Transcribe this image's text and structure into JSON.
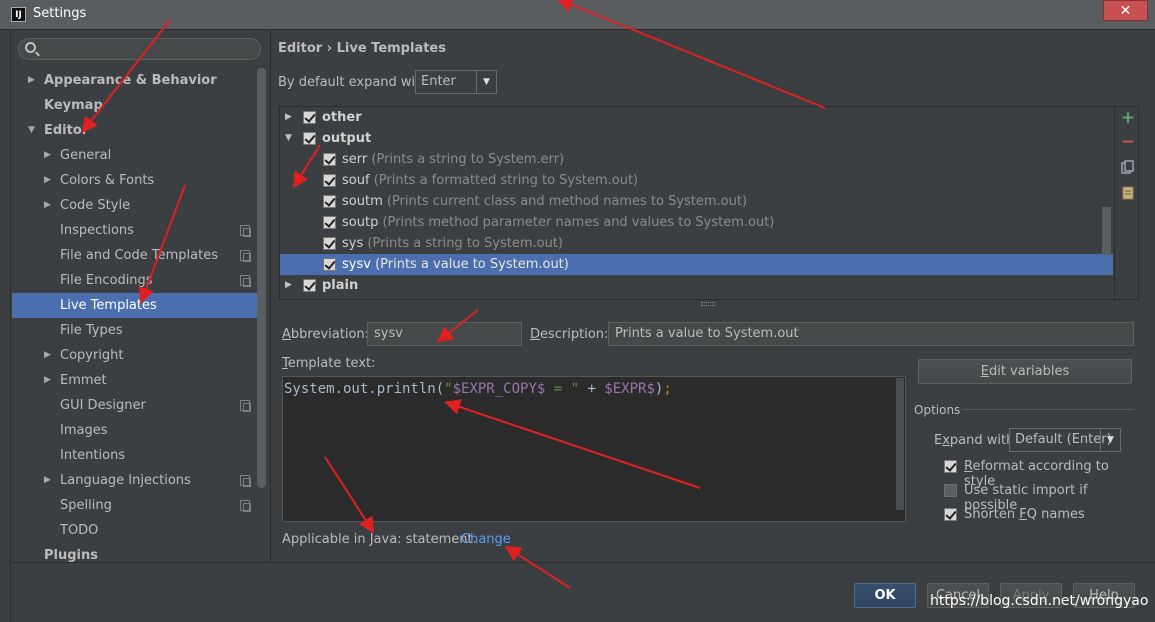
{
  "window": {
    "title": "Settings",
    "app_icon": "IJ",
    "close_glyph": "✕"
  },
  "sidebar": {
    "search_placeholder": "",
    "items": [
      {
        "label": "Appearance & Behavior",
        "arrow": "▶"
      },
      {
        "label": "Keymap",
        "arrow": ""
      },
      {
        "label": "Editor",
        "arrow": "▼"
      },
      {
        "label": "General",
        "arrow": "▶"
      },
      {
        "label": "Colors & Fonts",
        "arrow": "▶"
      },
      {
        "label": "Code Style",
        "arrow": "▶"
      },
      {
        "label": "Inspections",
        "arrow": ""
      },
      {
        "label": "File and Code Templates",
        "arrow": ""
      },
      {
        "label": "File Encodings",
        "arrow": ""
      },
      {
        "label": "Live Templates",
        "arrow": ""
      },
      {
        "label": "File Types",
        "arrow": ""
      },
      {
        "label": "Copyright",
        "arrow": "▶"
      },
      {
        "label": "Emmet",
        "arrow": "▶"
      },
      {
        "label": "GUI Designer",
        "arrow": ""
      },
      {
        "label": "Images",
        "arrow": ""
      },
      {
        "label": "Intentions",
        "arrow": ""
      },
      {
        "label": "Language Injections",
        "arrow": "▶"
      },
      {
        "label": "Spelling",
        "arrow": ""
      },
      {
        "label": "TODO",
        "arrow": ""
      },
      {
        "label": "Plugins",
        "arrow": ""
      }
    ]
  },
  "breadcrumb": {
    "parent": "Editor",
    "sep": "›",
    "current": "Live Templates"
  },
  "expand_with": {
    "label": "By default expand with",
    "value": "Enter",
    "arrow": "▼"
  },
  "templates": {
    "groups": [
      {
        "name": "other",
        "arrow": "▶"
      },
      {
        "name": "output",
        "arrow": "▼"
      },
      {
        "name": "plain",
        "arrow": "▶"
      }
    ],
    "items": [
      {
        "name": "serr",
        "desc": "(Prints a string to System.err)"
      },
      {
        "name": "souf",
        "desc": "(Prints a formatted string to System.out)"
      },
      {
        "name": "soutm",
        "desc": "(Prints current class and method names to System.out)"
      },
      {
        "name": "soutp",
        "desc": "(Prints method parameter names and values to System.out)"
      },
      {
        "name": "sys",
        "desc": "(Prints a string to System.out)"
      },
      {
        "name": "sysv",
        "desc": "(Prints a value to System.out)"
      }
    ],
    "tools": {
      "add": "+",
      "remove": "−"
    }
  },
  "form": {
    "abbreviation_label_u": "A",
    "abbreviation_label_rest": "bbreviation:",
    "abbreviation_value": "sysv",
    "description_label_u": "D",
    "description_label_rest": "escription:",
    "description_value": "Prints a value to System.out",
    "template_text_label_u": "T",
    "template_text_label_rest": "emplate text:",
    "code": {
      "p1": "System.out.println(",
      "s1": "\"",
      "v1": "$EXPR_COPY$",
      "s2": " = \"",
      "p2": " + ",
      "v2": "$EXPR$",
      "p3": ")",
      "p4": ";"
    },
    "edit_variables_u": "E",
    "edit_variables_rest": "dit variables",
    "applicable_text": "Applicable in Java: statement.",
    "change_link": "Change"
  },
  "options": {
    "title": "Options",
    "expand_with_label_pre": "E",
    "expand_with_label_u": "x",
    "expand_with_label_rest": "pand with",
    "expand_with_value": "Default (Enter)",
    "arrow": "▼",
    "reformat_u": "R",
    "reformat_rest": "eformat according to style",
    "static_import_label": "Use static import if possible",
    "shorten_pre": "Shorten ",
    "shorten_u": "F",
    "shorten_rest": "Q names"
  },
  "buttons": {
    "ok": "OK",
    "cancel": "Cancel",
    "apply": "Apply",
    "help": "Help"
  },
  "watermark": "https://blog.csdn.net/wrongyao"
}
